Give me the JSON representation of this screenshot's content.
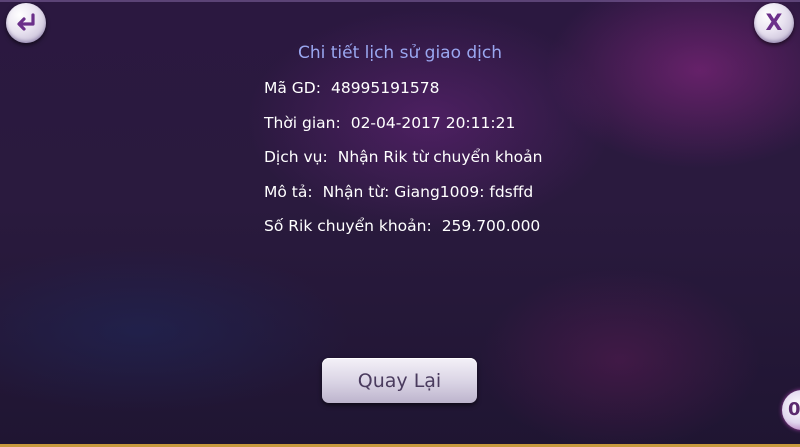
{
  "dialog": {
    "title": "Chi tiết lịch sử giao dịch",
    "back_icon": "back-arrow-icon",
    "close_label": "X",
    "close_icon": "close-icon",
    "accent_color": "#9aa7f0"
  },
  "transaction": {
    "rows": [
      {
        "label": "Mã GD:",
        "value": "48995191578"
      },
      {
        "label": "Thời gian:",
        "value": "02-04-2017 20:11:21"
      },
      {
        "label": "Dịch vụ:",
        "value": "Nhận Rik từ chuyển khoản"
      },
      {
        "label": "Mô tả:",
        "value": "Nhận từ: Giang1009: fdsffd"
      },
      {
        "label": "Số Rik chuyển khoản:",
        "value": "259.700.000"
      }
    ]
  },
  "footer": {
    "back_button_label": "Quay Lại",
    "corner_badge": "0"
  }
}
